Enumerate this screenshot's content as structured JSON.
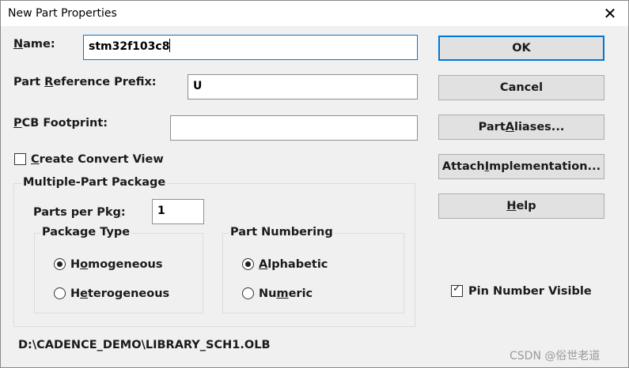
{
  "window": {
    "title": "New Part Properties",
    "close_symbol": "✕"
  },
  "fields": {
    "name": {
      "label_ul": "N",
      "label_rest": "ame:",
      "value": "stm32f103c8"
    },
    "prefix": {
      "label_pre": "Part ",
      "label_ul": "R",
      "label_rest": "eference Prefix:",
      "value": "U"
    },
    "footprint": {
      "label_ul": "P",
      "label_rest": "CB Footprint:",
      "value": ""
    }
  },
  "create_convert": {
    "label_ul": "C",
    "label_rest": "reate Convert View",
    "checked": false
  },
  "multi_part": {
    "title": "Multiple-Part Package",
    "parts_label_pre": "Parts per Pk",
    "parts_label_ul": "g",
    "parts_label_post": ":",
    "parts_value": "1",
    "package_type": {
      "title": "Package Type",
      "homogeneous": {
        "pre": "H",
        "ul": "o",
        "rest": "mogeneous",
        "selected": true
      },
      "heterogeneous": {
        "pre": "H",
        "ul": "e",
        "rest": "terogeneous",
        "selected": false
      }
    },
    "part_numbering": {
      "title": "Part Numbering",
      "alphabetic": {
        "pre": "",
        "ul": "A",
        "rest": "lphabetic",
        "selected": true
      },
      "numeric": {
        "pre": "Nu",
        "ul": "m",
        "rest": "eric",
        "selected": false
      }
    }
  },
  "buttons": {
    "ok": "OK",
    "cancel": "Cancel",
    "aliases": {
      "pre": "Part ",
      "ul": "A",
      "rest": "liases..."
    },
    "attach": {
      "pre": "Attach ",
      "ul": "I",
      "rest": "mplementation..."
    },
    "help": {
      "pre": "",
      "ul": "H",
      "rest": "elp"
    }
  },
  "pin_number": {
    "label": "Pin Number Visible",
    "checked": true,
    "check_symbol": "✓"
  },
  "library_path": "D:\\CADENCE_DEMO\\LIBRARY_SCH1.OLB",
  "watermark": "CSDN @俗世老道"
}
